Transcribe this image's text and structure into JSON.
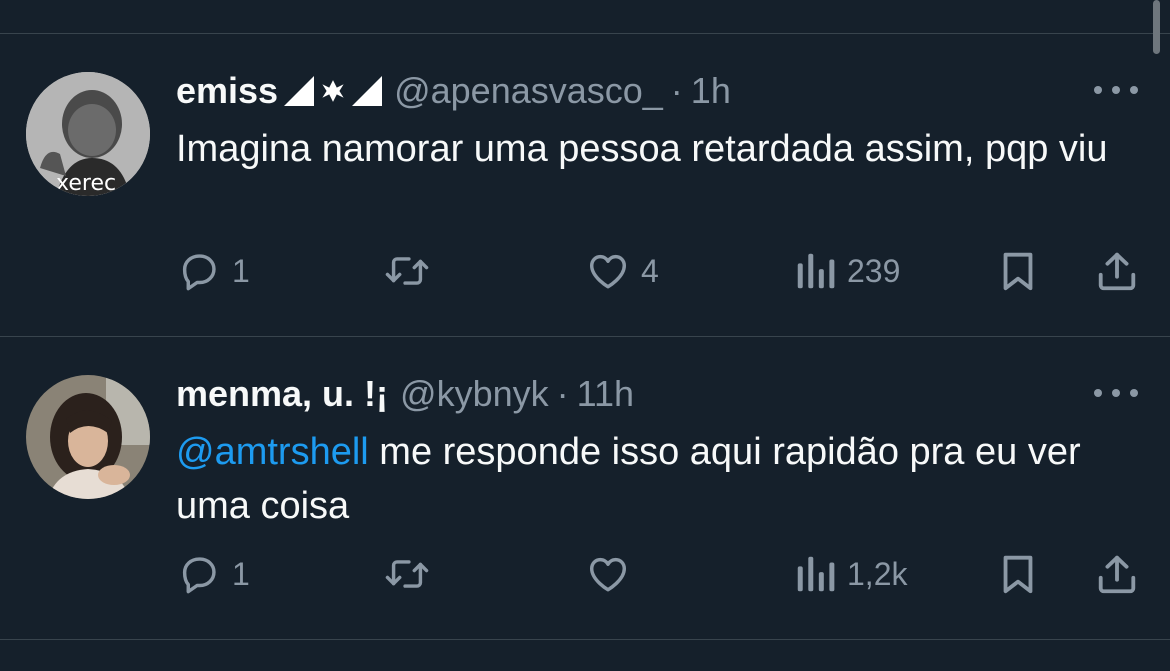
{
  "tweets": [
    {
      "display_name": "emiss",
      "name_badges": [
        "flag-vasco-icon",
        "maltese-cross-icon",
        "flag-vasco-icon"
      ],
      "handle": "@apenasvasco_",
      "separator": "·",
      "time": "1h",
      "avatar_caption": "xerec",
      "text_parts": [
        {
          "type": "text",
          "value": "Imagina namorar uma pessoa retardada assim, pqp viu"
        }
      ],
      "replies": "1",
      "retweets": "",
      "likes": "4",
      "views": "239"
    },
    {
      "display_name": "menma, u. !¡",
      "handle": "@kybnyk",
      "separator": "·",
      "time": "11h",
      "text_parts": [
        {
          "type": "mention",
          "value": "@amtrshell"
        },
        {
          "type": "text",
          "value": " me responde isso aqui rapidão pra eu ver uma coisa"
        }
      ],
      "replies": "1",
      "retweets": "",
      "likes": "",
      "views": "1,2k"
    }
  ],
  "colors": {
    "background": "#15202b",
    "divider": "#38444d",
    "primary_text": "#f7f9f9",
    "secondary_text": "#8b98a5",
    "accent": "#1d9bf0"
  }
}
